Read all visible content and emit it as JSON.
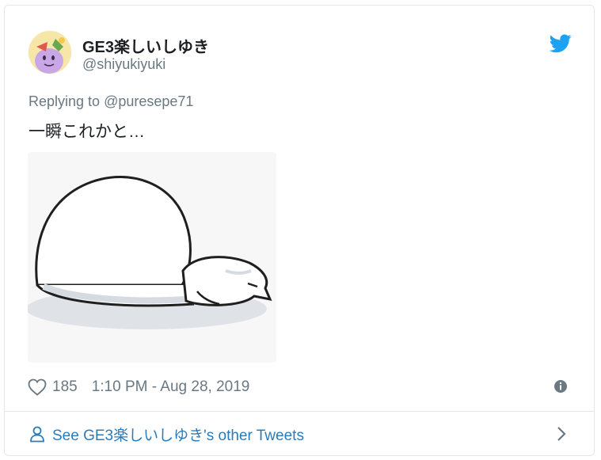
{
  "tweet": {
    "display_name": "GE3楽しいしゆき",
    "handle": "@shiyukiyuki",
    "reply_prefix": "Replying to ",
    "reply_to": "@puresepe71",
    "text": "一瞬これかと…",
    "like_count": "185",
    "timestamp": "1:10 PM - Aug 28, 2019"
  },
  "footer": {
    "link_label": "See GE3楽しいしゆき's other Tweets"
  },
  "icons": {
    "brand": "twitter-bird-icon",
    "like": "heart-icon",
    "info": "info-icon",
    "profile": "person-icon",
    "chevron": "chevron-right-icon"
  },
  "colors": {
    "twitter_blue": "#1da1f2",
    "link_blue": "#2b7bb9",
    "secondary_text": "#697882",
    "primary_text": "#1c2022",
    "border": "#e1e8ed"
  }
}
